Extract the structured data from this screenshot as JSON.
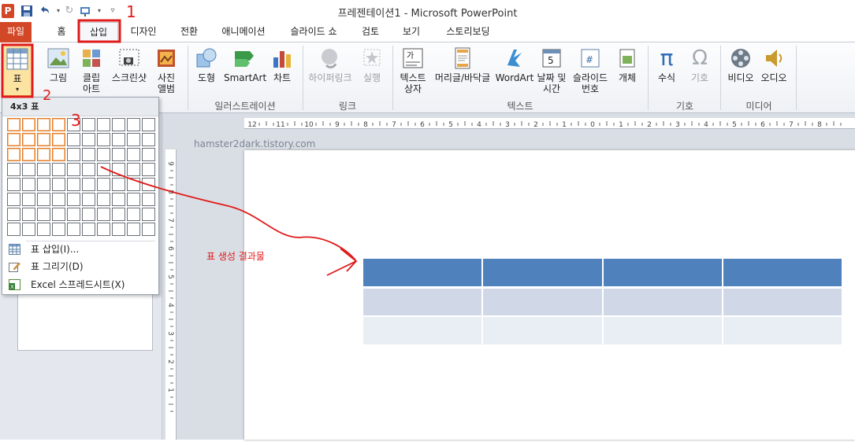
{
  "window": {
    "title": "프레젠테이션1  -  Microsoft PowerPoint"
  },
  "tabs": [
    "파일",
    "홈",
    "삽입",
    "디자인",
    "전환",
    "애니메이션",
    "슬라이드 쇼",
    "검토",
    "보기",
    "스토리보딩"
  ],
  "ribbon": {
    "buttons": [
      "표",
      "그림",
      "클립\n아트",
      "스크린샷",
      "사진\n앨범",
      "도형",
      "SmartArt",
      "차트",
      "하이퍼링크",
      "실행",
      "텍스트\n상자",
      "머리글/바닥글",
      "WordArt",
      "날짜 및\n시간",
      "슬라이드\n번호",
      "개체",
      "수식",
      "기호",
      "비디오",
      "오디오"
    ],
    "groups": [
      "일러스트레이션",
      "링크",
      "텍스트",
      "기호",
      "미디어"
    ]
  },
  "table_dropdown": {
    "header": "4x3 표",
    "grid_cols": 10,
    "grid_rows": 8,
    "selected_cols": 4,
    "selected_rows": 3,
    "items": [
      "표 삽입(I)...",
      "표 그리기(D)",
      "Excel 스프레드시트(X)"
    ]
  },
  "annotations": {
    "step1": "1",
    "step2": "2",
    "step3": "3",
    "result_label": "표 생성 결과물",
    "watermark": "hamster2dark.tistory.com"
  },
  "ruler": {
    "h_labels": [
      "12",
      "11",
      "10",
      "9",
      "8",
      "7",
      "6",
      "5",
      "4",
      "3",
      "2",
      "1",
      "0",
      "1",
      "2",
      "3",
      "4",
      "5",
      "6",
      "7",
      "8"
    ],
    "v_labels": [
      "9",
      "8",
      "7",
      "6",
      "5",
      "4",
      "3",
      "2",
      "1"
    ]
  },
  "colors": {
    "file_tab": "#d24726",
    "table_header": "#4f81bd",
    "table_band1": "#d0d8e8",
    "table_band2": "#e9edf4",
    "annotation_red": "#e01b1b",
    "grid_selected": "#e07b2b"
  }
}
